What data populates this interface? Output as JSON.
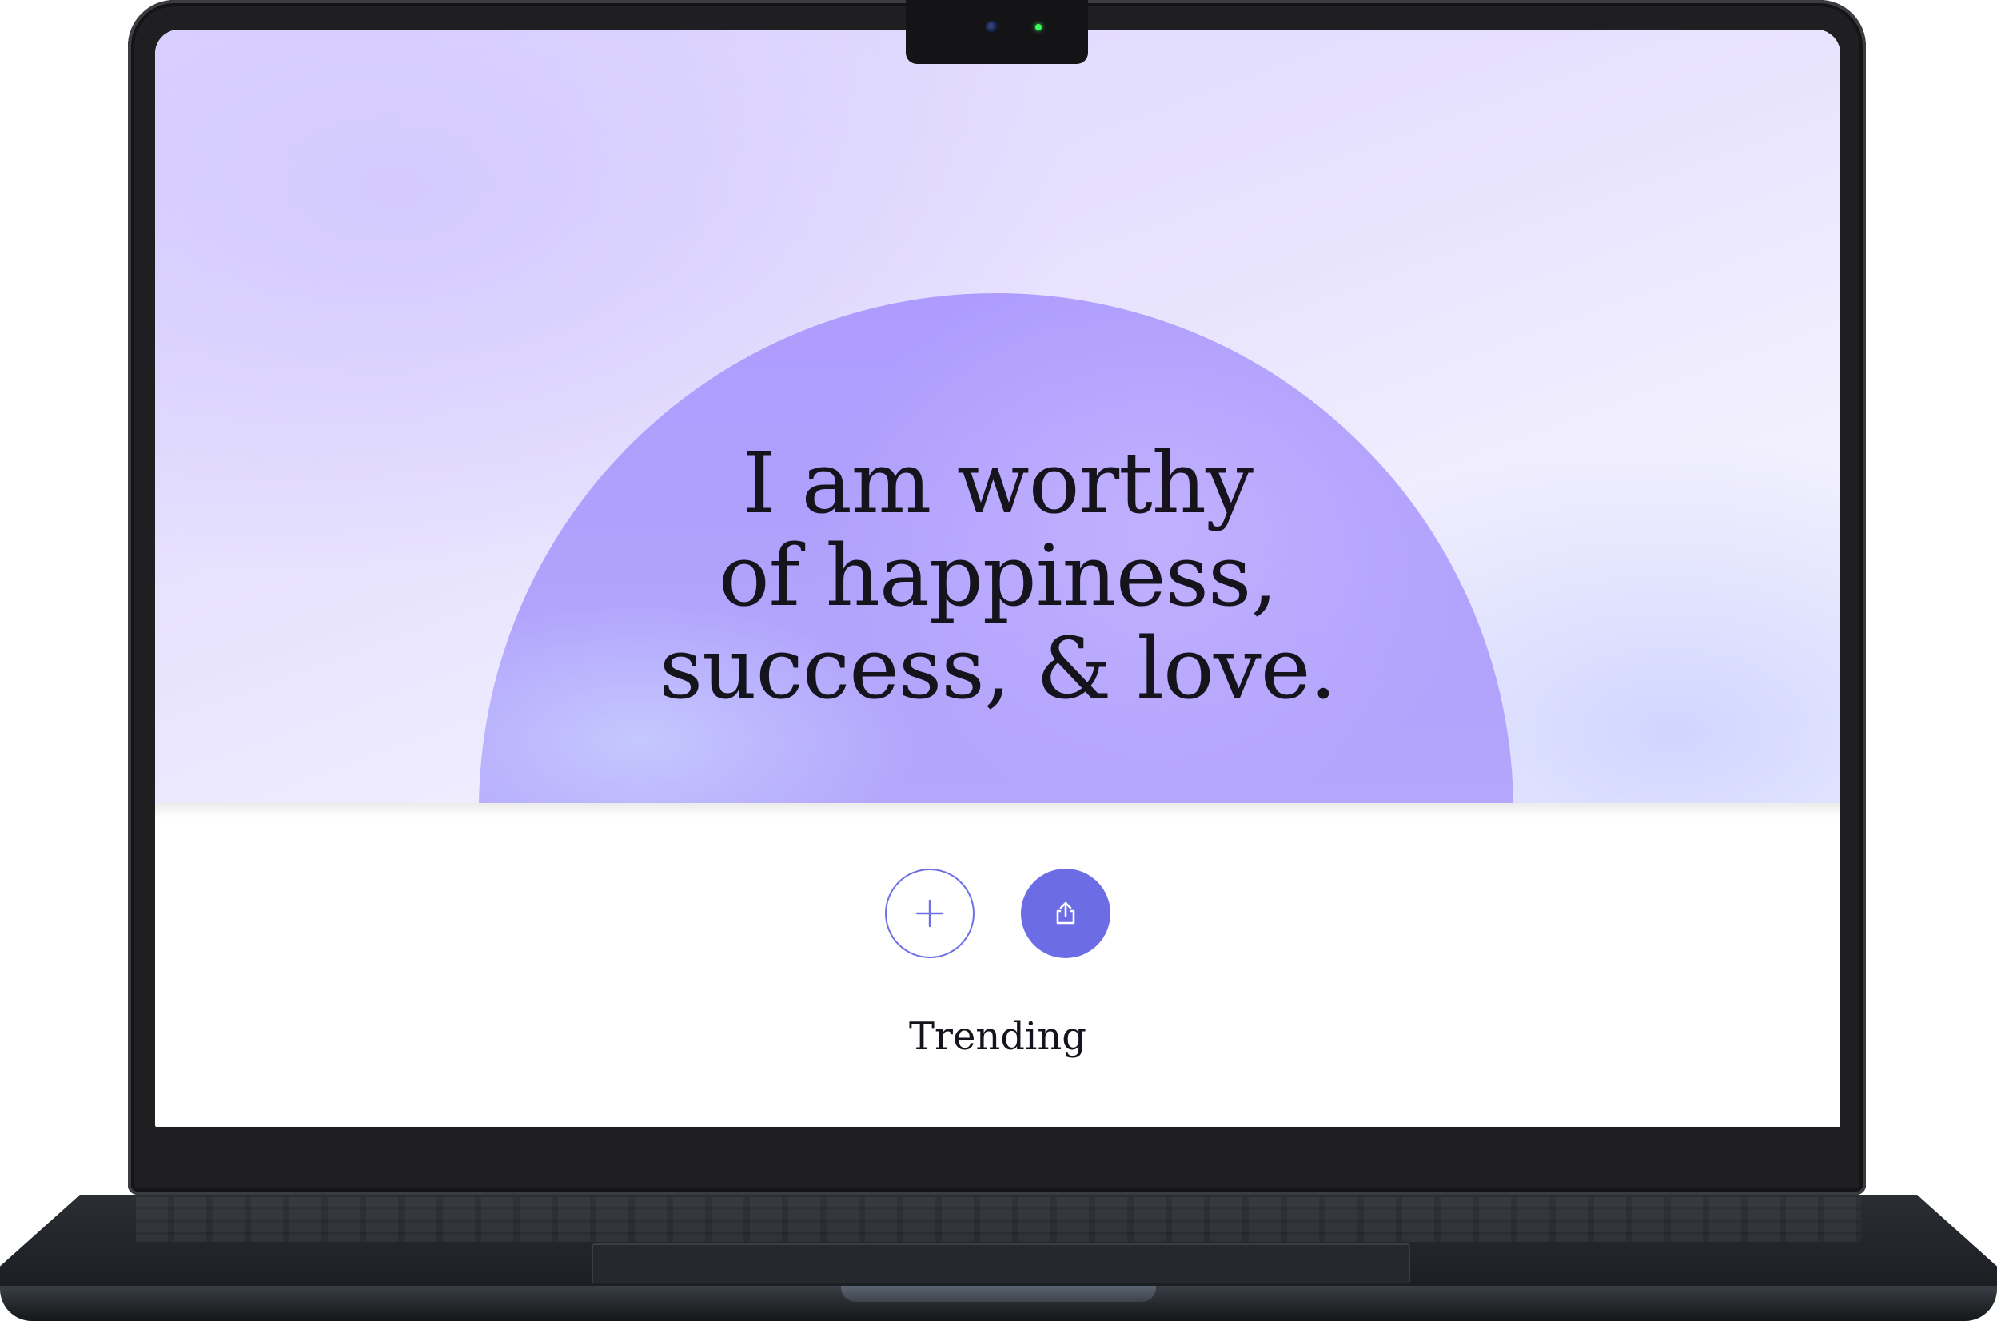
{
  "affirmation": {
    "text": "I am worthy\nof happiness,\nsuccess, & love."
  },
  "actions": {
    "add_icon": "plus-icon",
    "share_icon": "share-icon"
  },
  "section": {
    "title": "Trending"
  },
  "colors": {
    "accent": "#6c6de4",
    "arch": "#b3a6fc",
    "background_top": "#dcd4fd",
    "text": "#15131c"
  }
}
